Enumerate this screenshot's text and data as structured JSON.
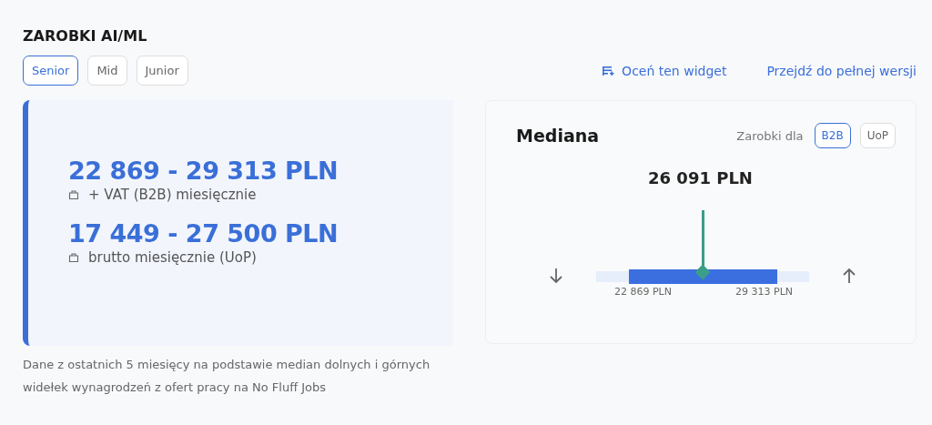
{
  "title": "ZAROBKI AI/ML",
  "levels": [
    {
      "label": "Senior",
      "selected": true
    },
    {
      "label": "Mid",
      "selected": false
    },
    {
      "label": "Junior",
      "selected": false
    }
  ],
  "links": [
    {
      "label": "Oceń ten widget",
      "kind": "rate"
    },
    {
      "label": "Przejdź do pełnej wersji",
      "kind": "plain"
    }
  ],
  "salaries": [
    {
      "range": "22 869 - 29 313 PLN",
      "note": "+ VAT (B2B) miesięcznie"
    },
    {
      "range": "17 449 - 27 500 PLN",
      "note": "brutto miesięcznie (UoP)"
    }
  ],
  "footnote": "Dane z ostatnich 5 miesięcy na podstawie median dolnych i górnych widełek wynagrodzeń z ofert pracy na No Fluff Jobs",
  "median": {
    "title": "Mediana",
    "contract_label": "Zarobki dla",
    "contracts": [
      {
        "label": "B2B",
        "selected": true
      },
      {
        "label": "UoP",
        "selected": false
      }
    ],
    "value": "26 091 PLN",
    "level": 0.5,
    "low": "22 869 PLN",
    "high": "29 313 PLN"
  }
}
